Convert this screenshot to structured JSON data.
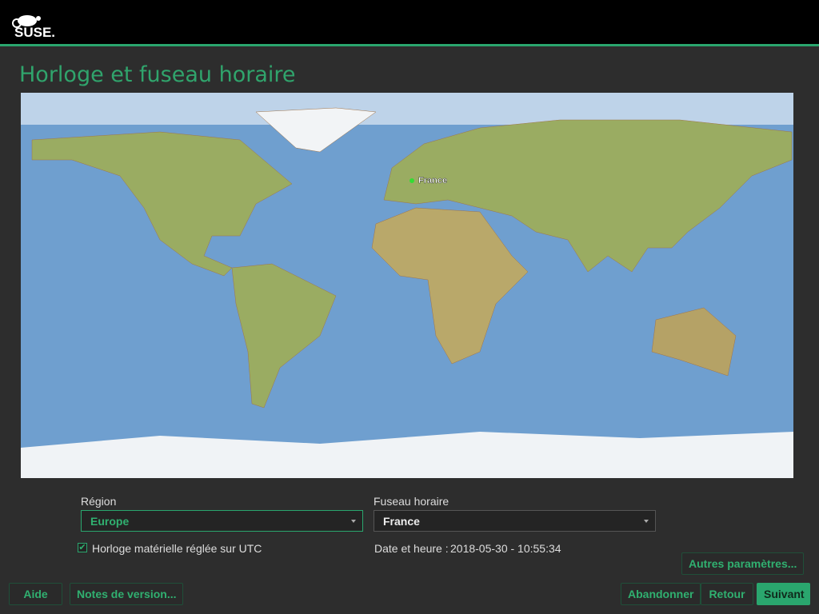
{
  "header": {
    "logo_text": "SUSE"
  },
  "page_title": "Horloge et fuseau horaire",
  "map": {
    "marker_label": "France",
    "marker_color": "#33dd33"
  },
  "region": {
    "label": "Région",
    "value": "Europe"
  },
  "timezone": {
    "label": "Fuseau horaire",
    "value": "France"
  },
  "hwclock": {
    "label": "Horloge matérielle réglée sur UTC",
    "checked": true
  },
  "datetime": {
    "label": "Date et heure :",
    "value": "2018-05-30 - 10:55:34"
  },
  "buttons": {
    "other_settings": "Autres paramètres...",
    "help": "Aide",
    "release_notes": "Notes de version...",
    "abort": "Abandonner",
    "back": "Retour",
    "next": "Suivant"
  },
  "colors": {
    "accent": "#2aa66e",
    "background": "#2d2d2d"
  }
}
